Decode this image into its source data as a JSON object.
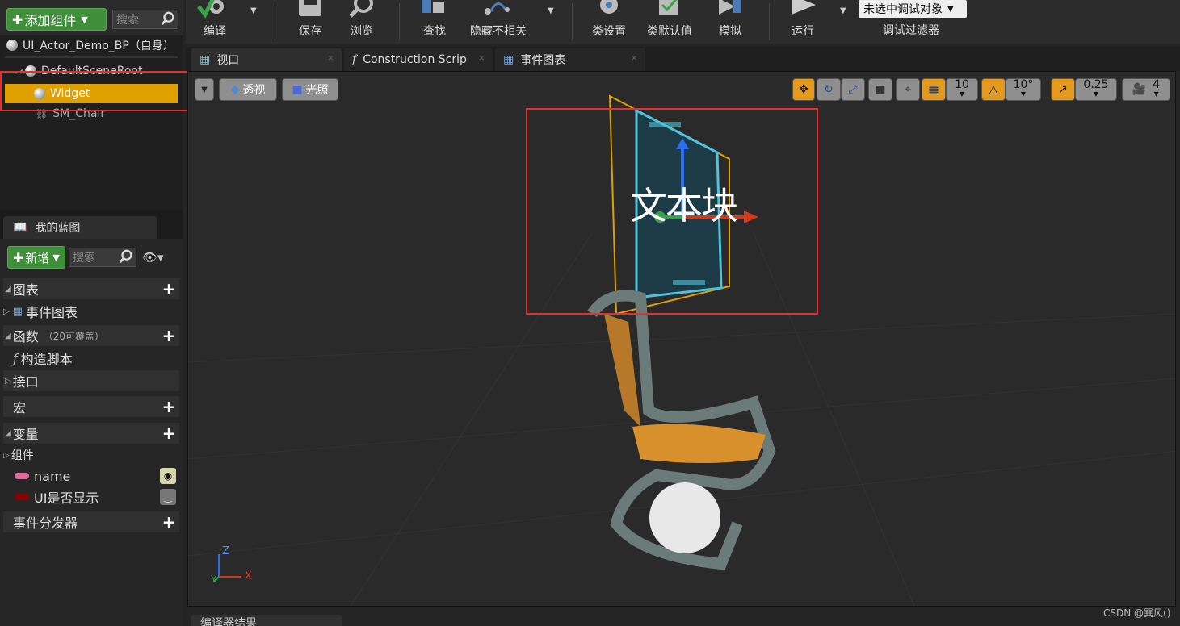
{
  "components": {
    "add_label": "添加组件",
    "search_placeholder": "搜索",
    "self_label": "UI_Actor_Demo_BP（自身）",
    "items": [
      "DefaultSceneRoot",
      "Widget",
      "SM_Chair"
    ]
  },
  "my_blueprint": {
    "tab_label": "我的蓝图",
    "new_label": "新增",
    "search_placeholder": "搜索",
    "sections": {
      "graphs": "图表",
      "event_graph": "事件图表",
      "functions": "函数",
      "functions_note": "（20可覆盖）",
      "construct_script": "构造脚本",
      "interfaces": "接口",
      "macros": "宏",
      "variables": "变量",
      "components": "组件",
      "var_name": "name",
      "var_ui": "UI是否显示",
      "dispatchers": "事件分发器"
    }
  },
  "toolbar": {
    "compile": "编译",
    "save": "保存",
    "browse": "浏览",
    "find": "查找",
    "hide_unrelated": "隐藏不相关",
    "class_settings": "类设置",
    "class_defaults": "类默认值",
    "simulate": "模拟",
    "play": "运行",
    "debug_object": "未选中调试对象",
    "debug_filter": "调试过滤器"
  },
  "tabs": {
    "viewport": "视口",
    "construction": "Construction Scrip",
    "event_graph": "事件图表"
  },
  "viewport": {
    "perspective": "透视",
    "lighting": "光照",
    "grid_snap": "10",
    "rot_snap": "10°",
    "scale_snap": "0.25",
    "cam_speed": "4",
    "widget_text": "文本块",
    "axis_x": "X",
    "axis_y": "Y",
    "axis_z": "Z"
  },
  "bottom_tab": "编译器结果",
  "watermark": "CSDN @巽风()"
}
